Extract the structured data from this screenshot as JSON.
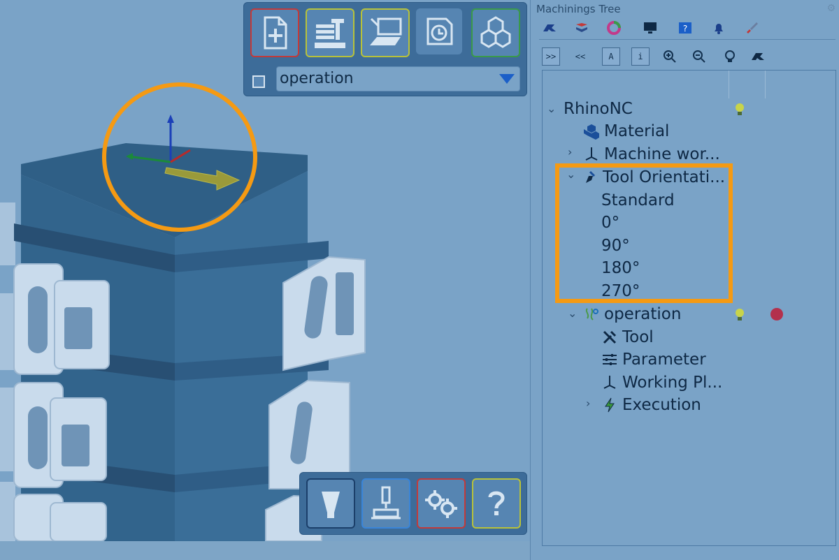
{
  "viewport": {
    "operation_select": "operation",
    "top_toolbar": [
      "new-document-icon",
      "stock-setup-icon",
      "machine-icon",
      "clock-icon",
      "cubes-icon"
    ],
    "bottom_toolbar": [
      "tool-cone-icon",
      "spindle-machine-icon",
      "gears-icon",
      "help-icon"
    ]
  },
  "panel": {
    "title": "Machinings Tree",
    "tabs": [
      "rhino-icon",
      "layers-icon",
      "color-wheel-icon",
      "monitor-icon",
      "help-box-icon",
      "bell-icon",
      "brush-icon"
    ],
    "toolbar": [
      ">>",
      "<<",
      "A",
      "i",
      "zoom-in-icon",
      "zoom-out-icon",
      "bulb-icon",
      "rhino-icon"
    ]
  },
  "tree": {
    "root": "RhinoNC",
    "material": "Material",
    "machine_work": "Machine wor...",
    "tool_orientation": "Tool Orientati...",
    "orientations": [
      "Standard",
      "0°",
      "90°",
      "180°",
      "270°"
    ],
    "operation": "operation",
    "tool": "Tool",
    "parameter": "Parameter",
    "working_plane": "Working Pl...",
    "execution": "Execution"
  },
  "colors": {
    "highlight": "#f59a13",
    "status_dot": "#b3314d",
    "bulb": "#c8d44a"
  }
}
